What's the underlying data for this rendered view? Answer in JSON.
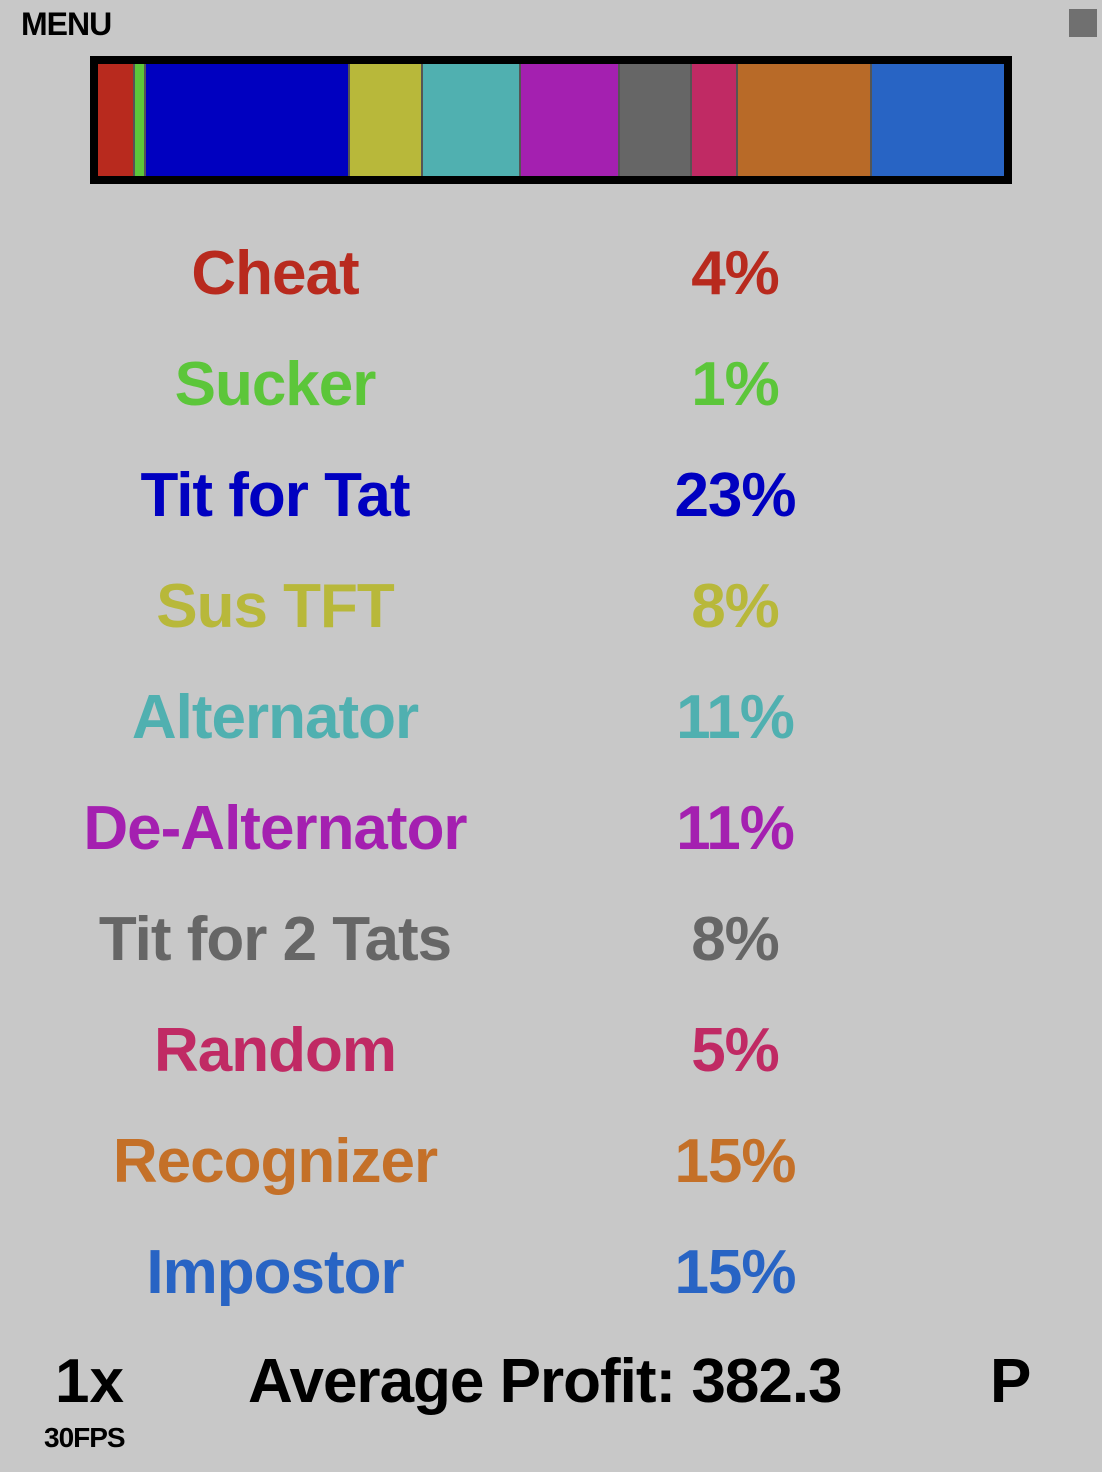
{
  "menu_label": "MENU",
  "population_bar": {
    "segments": [
      {
        "name": "Cheat",
        "share": 4,
        "color": "#b82a1e"
      },
      {
        "name": "Sucker",
        "share": 1,
        "color": "#5cc63a"
      },
      {
        "name": "Tit for Tat",
        "share": 23,
        "color": "#0000c0"
      },
      {
        "name": "Sus TFT",
        "share": 8,
        "color": "#b8b83a"
      },
      {
        "name": "Alternator",
        "share": 11,
        "color": "#50b0b0"
      },
      {
        "name": "De-Alternator",
        "share": 11,
        "color": "#a420b0"
      },
      {
        "name": "Tit for 2 Tats",
        "share": 8,
        "color": "#666666"
      },
      {
        "name": "Random",
        "share": 5,
        "color": "#c02a64"
      },
      {
        "name": "Recognizer",
        "share": 15,
        "color": "#b86a28"
      },
      {
        "name": "Impostor",
        "share": 15,
        "color": "#2864c4"
      }
    ]
  },
  "strategies": [
    {
      "name": "Cheat",
      "percent": "4%",
      "color": "#b82a1e"
    },
    {
      "name": "Sucker",
      "percent": "1%",
      "color": "#5cc63a"
    },
    {
      "name": "Tit for Tat",
      "percent": "23%",
      "color": "#0000c0"
    },
    {
      "name": "Sus TFT",
      "percent": "8%",
      "color": "#b8b83a"
    },
    {
      "name": "Alternator",
      "percent": "11%",
      "color": "#50b0b0"
    },
    {
      "name": "De-Alternator",
      "percent": "11%",
      "color": "#a420b0"
    },
    {
      "name": "Tit for 2 Tats",
      "percent": "8%",
      "color": "#666666"
    },
    {
      "name": "Random",
      "percent": "5%",
      "color": "#c02a64"
    },
    {
      "name": "Recognizer",
      "percent": "15%",
      "color": "#c47028"
    },
    {
      "name": "Impostor",
      "percent": "15%",
      "color": "#2864c4"
    }
  ],
  "footer": {
    "speed": "1x",
    "fps": "30FPS",
    "average_profit": "Average Profit: 382.3",
    "pause_key": "P"
  }
}
